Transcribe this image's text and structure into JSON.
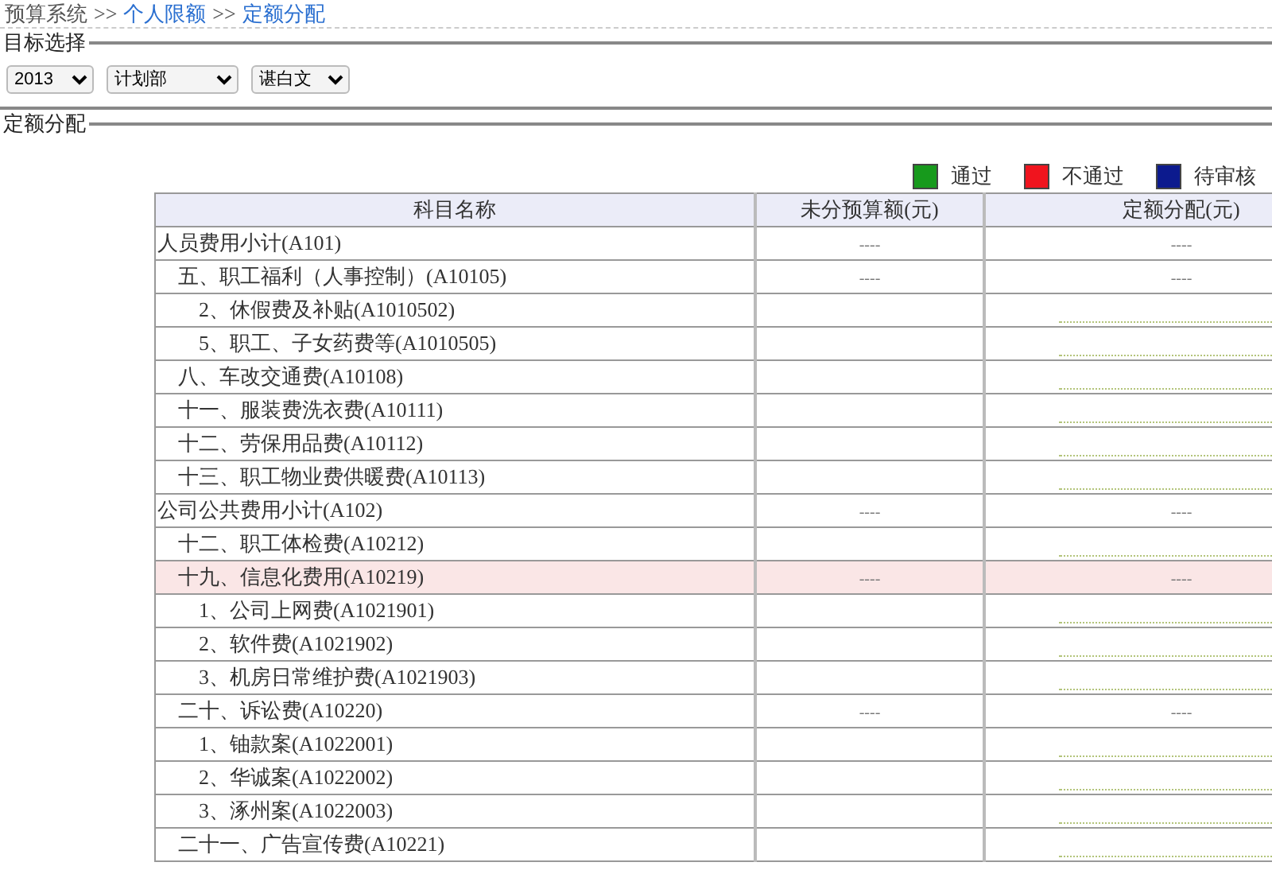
{
  "breadcrumb": [
    {
      "kind": "text",
      "text": "预算系统"
    },
    {
      "kind": "separator",
      "text": ">>"
    },
    {
      "kind": "link",
      "text": "个人限额"
    },
    {
      "kind": "separator",
      "text": ">>"
    },
    {
      "kind": "link",
      "text": "定额分配"
    }
  ],
  "filter_section": {
    "title": "目标选择",
    "selects": [
      {
        "value": "2013"
      },
      {
        "value": "计划部"
      },
      {
        "value": "谌白文"
      }
    ]
  },
  "quota_section": {
    "title": "定额分配",
    "legend": [
      {
        "label": "通过",
        "color": "#179a1c"
      },
      {
        "label": "不通过",
        "color": "#f0141e"
      },
      {
        "label": "待审核",
        "color": "#0c1a8e"
      }
    ],
    "table": {
      "columns": [
        "科目名称",
        "未分预算额(元)",
        "定额分配(元)"
      ],
      "rows": [
        {
          "name": "人员费用小计(A101)",
          "kind": "group",
          "selected": false,
          "unallocated": "----",
          "allocation": "----",
          "children": [
            {
              "name": "五、职工福利（人事控制）(A10105)",
              "kind": "group",
              "selected": false,
              "unallocated": "----",
              "allocation": "----",
              "children": [
                {
                  "name": "2、休假费及补贴(A1010502)",
                  "kind": "input",
                  "selected": false
                },
                {
                  "name": "5、职工、子女药费等(A1010505)",
                  "kind": "input",
                  "selected": false
                }
              ]
            },
            {
              "name": "八、车改交通费(A10108)",
              "kind": "input",
              "selected": false
            },
            {
              "name": "十一、服装费洗衣费(A10111)",
              "kind": "input",
              "selected": false
            },
            {
              "name": "十二、劳保用品费(A10112)",
              "kind": "input",
              "selected": false
            },
            {
              "name": "十三、职工物业费供暖费(A10113)",
              "kind": "input",
              "selected": false
            }
          ]
        },
        {
          "name": "公司公共费用小计(A102)",
          "kind": "group",
          "selected": false,
          "unallocated": "----",
          "allocation": "----",
          "children": [
            {
              "name": "十二、职工体检费(A10212)",
              "kind": "input",
              "selected": false
            },
            {
              "name": "十九、信息化费用(A10219)",
              "kind": "group",
              "selected": true,
              "unallocated": "----",
              "allocation": "----",
              "children": [
                {
                  "name": "1、公司上网费(A1021901)",
                  "kind": "input",
                  "selected": false
                },
                {
                  "name": "2、软件费(A1021902)",
                  "kind": "input",
                  "selected": false
                },
                {
                  "name": "3、机房日常维护费(A1021903)",
                  "kind": "input",
                  "selected": false
                }
              ]
            },
            {
              "name": "二十、诉讼费(A10220)",
              "kind": "group",
              "selected": false,
              "unallocated": "----",
              "allocation": "----",
              "children": [
                {
                  "name": "1、铀款案(A1022001)",
                  "kind": "input",
                  "selected": false
                },
                {
                  "name": "2、华诚案(A1022002)",
                  "kind": "input",
                  "selected": false
                },
                {
                  "name": "3、涿州案(A1022003)",
                  "kind": "input",
                  "selected": false
                }
              ]
            },
            {
              "name": "二十一、广告宣传费(A10221)",
              "kind": "input",
              "selected": false
            }
          ]
        }
      ]
    }
  }
}
